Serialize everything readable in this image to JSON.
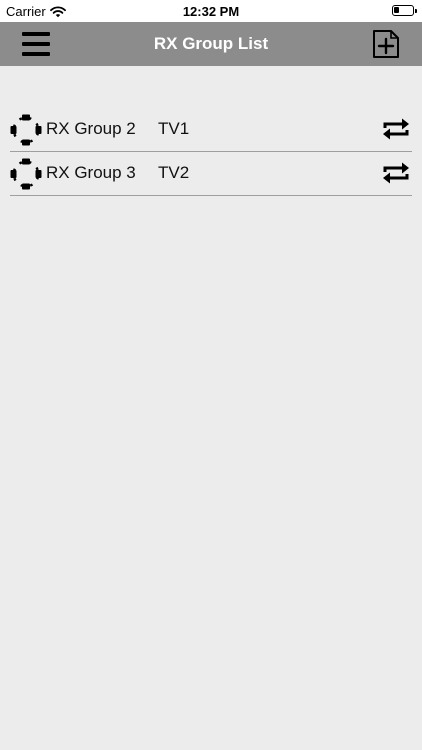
{
  "status_bar": {
    "carrier": "Carrier",
    "time": "12:32 PM",
    "battery_level": 0.3
  },
  "nav": {
    "title": "RX Group List",
    "menu_icon": "hamburger-menu-icon",
    "add_icon": "add-document-icon"
  },
  "groups": [
    {
      "name": "RX Group 2",
      "tv": "TV1",
      "icon": "target-group-icon",
      "action_icon": "repeat-icon"
    },
    {
      "name": "RX Group 3",
      "tv": "TV2",
      "icon": "target-group-icon",
      "action_icon": "repeat-icon"
    }
  ],
  "colors": {
    "nav_background": "#8c8c8c",
    "page_background": "#ececec",
    "divider": "#9f9f9f",
    "nav_title": "#ffffff"
  }
}
